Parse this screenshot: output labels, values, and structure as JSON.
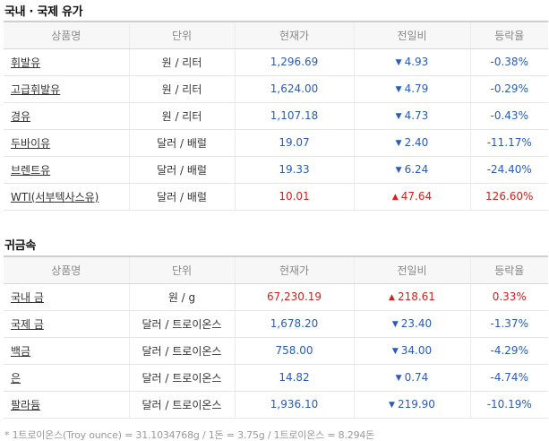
{
  "oil_section": {
    "title": "국내 · 국제 유가",
    "headers": [
      "상품명",
      "단위",
      "현재가",
      "전일비",
      "등락율"
    ],
    "rows": [
      {
        "name": "휘발유",
        "unit": "원 / 리터",
        "price": "1,296.69",
        "dir": "down",
        "change": "4.93",
        "rate": "-0.38%"
      },
      {
        "name": "고급휘발유",
        "unit": "원 / 리터",
        "price": "1,624.00",
        "dir": "down",
        "change": "4.79",
        "rate": "-0.29%"
      },
      {
        "name": "경유",
        "unit": "원 / 리터",
        "price": "1,107.18",
        "dir": "down",
        "change": "4.73",
        "rate": "-0.43%"
      },
      {
        "name": "두바이유",
        "unit": "달러 / 배럴",
        "price": "19.07",
        "dir": "down",
        "change": "2.40",
        "rate": "-11.17%"
      },
      {
        "name": "브렌트유",
        "unit": "달러 / 배럴",
        "price": "19.33",
        "dir": "down",
        "change": "6.24",
        "rate": "-24.40%"
      },
      {
        "name": "WTI(서부텍사스유)",
        "unit": "달러 / 배럴",
        "price": "10.01",
        "dir": "up",
        "change": "47.64",
        "rate": "126.60%"
      }
    ]
  },
  "metal_section": {
    "title": "귀금속",
    "headers": [
      "상품명",
      "단위",
      "현재가",
      "전일비",
      "등락율"
    ],
    "rows": [
      {
        "name": "국내 금",
        "unit": "원 / g",
        "price": "67,230.19",
        "dir": "up",
        "change": "218.61",
        "rate": "0.33%"
      },
      {
        "name": "국제 금",
        "unit": "달러 / 트로이온스",
        "price": "1,678.20",
        "dir": "down",
        "change": "23.40",
        "rate": "-1.37%"
      },
      {
        "name": "백금",
        "unit": "달러 / 트로이온스",
        "price": "758.00",
        "dir": "down",
        "change": "34.00",
        "rate": "-4.29%"
      },
      {
        "name": "은",
        "unit": "달러 / 트로이온스",
        "price": "14.82",
        "dir": "down",
        "change": "0.74",
        "rate": "-4.74%"
      },
      {
        "name": "팔라듐",
        "unit": "달러 / 트로이온스",
        "price": "1,936.10",
        "dir": "down",
        "change": "219.90",
        "rate": "-10.19%"
      }
    ]
  },
  "arrows": {
    "up": "▲",
    "down": "▼"
  },
  "colors": {
    "up": "#d42020",
    "down": "#2a5bb6"
  },
  "footnote": "* 1트로이온스(Troy ounce) = 31.1034768g / 1돈 = 3.75g / 1트로이온스 = 8.294돈"
}
